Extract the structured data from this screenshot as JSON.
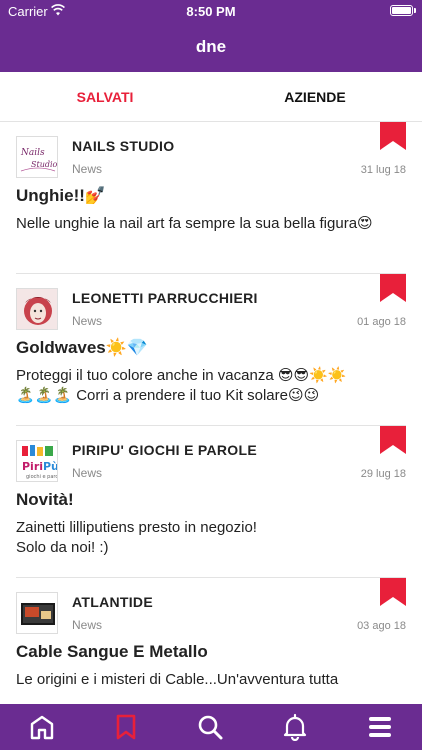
{
  "status_bar": {
    "carrier": "Carrier",
    "time": "8:50 PM",
    "battery_level": 1.0
  },
  "nav": {
    "title": "dne"
  },
  "tabs": [
    {
      "label": "SALVATI",
      "active": true
    },
    {
      "label": "AZIENDE",
      "active": false
    }
  ],
  "colors": {
    "brand": "#6a2c91",
    "accent": "#e8203a"
  },
  "feed": [
    {
      "company": "NAILS STUDIO",
      "category": "News",
      "date": "31 lug 18",
      "headline": "Unghie!!💅",
      "body": "Nelle unghie la nail art fa sempre la sua bella figura😍",
      "logo_text": "Nails Studio",
      "saved": true
    },
    {
      "company": "LEONETTI PARRUCCHIERI",
      "category": "News",
      "date": "01 ago 18",
      "headline": "Goldwaves☀️💎",
      "body": "Proteggi il tuo colore anche in vacanza 😎😎☀️☀️\n🏝️🏝️🏝️ Corri a prendere il tuo Kit solare😉😉",
      "logo_text": "",
      "saved": true
    },
    {
      "company": "PIRIPU' GIOCHI E PAROLE",
      "category": "News",
      "date": "29 lug 18",
      "headline": "Novità!",
      "body": "Zainetti lilliputiens presto in negozio!\nSolo da noi! :)",
      "logo_text": "PiriPù",
      "saved": true
    },
    {
      "company": "ATLANTIDE",
      "category": "News",
      "date": "03 ago 18",
      "headline": "Cable Sangue E Metallo",
      "body": "Le origini e i misteri di Cable...Un'avventura tutta",
      "logo_text": "",
      "saved": true
    }
  ],
  "bottom_tabs": [
    {
      "icon": "home-icon",
      "active": false
    },
    {
      "icon": "bookmark-icon",
      "active": true
    },
    {
      "icon": "search-icon",
      "active": false
    },
    {
      "icon": "bell-icon",
      "active": false
    },
    {
      "icon": "menu-icon",
      "active": false
    }
  ]
}
